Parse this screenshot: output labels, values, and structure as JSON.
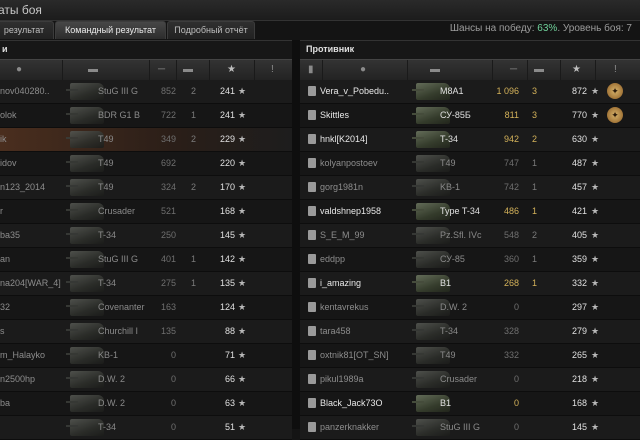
{
  "window": {
    "title": "аты боя"
  },
  "tabs": [
    {
      "label": "результат"
    },
    {
      "label": "Командный результат"
    },
    {
      "label": "Подробный отчёт"
    }
  ],
  "win_info": {
    "prefix": "Шансы на победу:",
    "percent": "63%",
    "level_text": ". Уровень боя: 7"
  },
  "left_team": {
    "title": "и",
    "players": [
      {
        "name": "nov040280..",
        "tank": "StuG III G",
        "damage": "852",
        "frags": "2",
        "xp": "241",
        "status": "dead"
      },
      {
        "name": "olok",
        "tank": "BDR G1 B",
        "damage": "722",
        "frags": "1",
        "xp": "241",
        "status": "dead"
      },
      {
        "name": "ik",
        "tank": "T49",
        "damage": "349",
        "frags": "2",
        "xp": "229",
        "status": "dead"
      },
      {
        "name": "idov",
        "tank": "T49",
        "damage": "692",
        "frags": "",
        "xp": "220",
        "status": "dead"
      },
      {
        "name": "n123_2014",
        "tank": "T49",
        "damage": "324",
        "frags": "2",
        "xp": "170",
        "status": "dead"
      },
      {
        "name": "r",
        "tank": "Crusader",
        "damage": "521",
        "frags": "",
        "xp": "168",
        "status": "dead"
      },
      {
        "name": "ba35",
        "tank": "T-34",
        "damage": "250",
        "frags": "",
        "xp": "145",
        "status": "dead"
      },
      {
        "name": "an",
        "tank": "StuG III G",
        "damage": "401",
        "frags": "1",
        "xp": "142",
        "status": "dead"
      },
      {
        "name": "na204[WAR_4]",
        "tank": "T-34",
        "damage": "275",
        "frags": "1",
        "xp": "135",
        "status": "dead"
      },
      {
        "name": "32",
        "tank": "Covenanter",
        "damage": "163",
        "frags": "",
        "xp": "124",
        "status": "dead"
      },
      {
        "name": "s",
        "tank": "Churchill I",
        "damage": "135",
        "frags": "",
        "xp": "88",
        "status": "dead"
      },
      {
        "name": "m_Halayko",
        "tank": "KB-1",
        "damage": "0",
        "frags": "",
        "xp": "71",
        "status": "dead"
      },
      {
        "name": "n2500hp",
        "tank": "D.W. 2",
        "damage": "0",
        "frags": "",
        "xp": "66",
        "status": "dead"
      },
      {
        "name": "ba",
        "tank": "D.W. 2",
        "damage": "0",
        "frags": "",
        "xp": "63",
        "status": "dead"
      },
      {
        "name": "",
        "tank": "T-34",
        "damage": "0",
        "frags": "",
        "xp": "51",
        "status": "dead"
      }
    ]
  },
  "right_team": {
    "title": "Противник",
    "players": [
      {
        "name": "Vera_v_Pobedu..",
        "tank": "M8A1",
        "damage": "1 096",
        "frags": "3",
        "xp": "872",
        "status": "alive",
        "medal": true
      },
      {
        "name": "Skittles",
        "tank": "СУ-85Б",
        "damage": "811",
        "frags": "3",
        "xp": "770",
        "status": "alive",
        "medal": true
      },
      {
        "name": "hnkl[K2014]",
        "tank": "T-34",
        "damage": "942",
        "frags": "2",
        "xp": "630",
        "status": "alive"
      },
      {
        "name": "kolyanpostoev",
        "tank": "T49",
        "damage": "747",
        "frags": "1",
        "xp": "487",
        "status": "dead"
      },
      {
        "name": "gorg1981n",
        "tank": "KB-1",
        "damage": "742",
        "frags": "1",
        "xp": "457",
        "status": "dead"
      },
      {
        "name": "valdshnep1958",
        "tank": "Type T-34",
        "damage": "486",
        "frags": "1",
        "xp": "421",
        "status": "alive"
      },
      {
        "name": "S_E_M_99",
        "tank": "Pz.Sfl. IVc",
        "damage": "548",
        "frags": "2",
        "xp": "405",
        "status": "dead"
      },
      {
        "name": "eddpp",
        "tank": "СУ-85",
        "damage": "360",
        "frags": "1",
        "xp": "359",
        "status": "dead"
      },
      {
        "name": "i_amazing",
        "tank": "B1",
        "damage": "268",
        "frags": "1",
        "xp": "332",
        "status": "alive"
      },
      {
        "name": "kentavrekus",
        "tank": "D.W. 2",
        "damage": "0",
        "frags": "",
        "xp": "297",
        "status": "dead"
      },
      {
        "name": "tara458",
        "tank": "T-34",
        "damage": "328",
        "frags": "",
        "xp": "279",
        "status": "dead"
      },
      {
        "name": "oxtnik81[OT_SN]",
        "tank": "T49",
        "damage": "332",
        "frags": "",
        "xp": "265",
        "status": "dead"
      },
      {
        "name": "pikul1989a",
        "tank": "Crusader",
        "damage": "0",
        "frags": "",
        "xp": "218",
        "status": "dead"
      },
      {
        "name": "Black_Jack73O",
        "tank": "B1",
        "damage": "0",
        "frags": "",
        "xp": "168",
        "status": "alive"
      },
      {
        "name": "panzerknakker",
        "tank": "StuG III G",
        "damage": "0",
        "frags": "",
        "xp": "145",
        "status": "dead"
      }
    ]
  },
  "icons": {
    "star": "★",
    "player": "person-icon",
    "tank": "tank-icon",
    "damage": "gun-icon",
    "frags": "tank-kill-icon",
    "exclamation": "!"
  }
}
